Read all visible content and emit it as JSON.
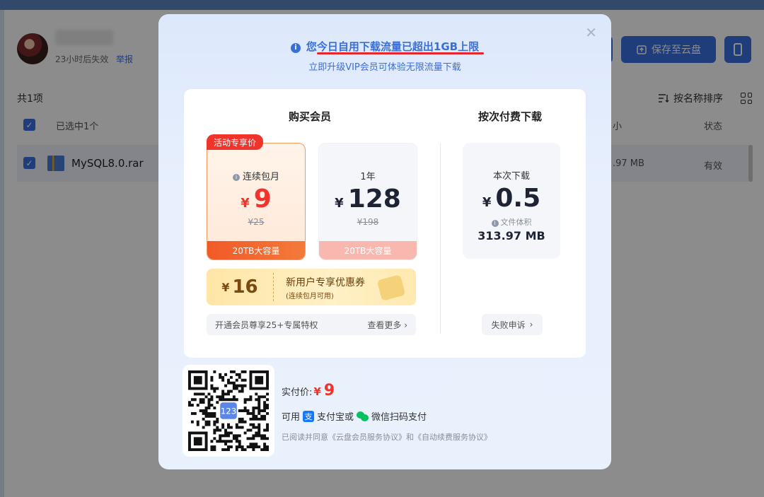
{
  "background": {
    "user": {
      "expire_text": "23小时后失效",
      "report_label": "举报"
    },
    "toolbar": {
      "save_label": "保存至云盘",
      "sort_label": "按名称排序"
    },
    "file_count": "共1项",
    "table": {
      "selected_text": "已选中1个",
      "size_header": "小",
      "status_header": "状态",
      "row": {
        "name": "MySQL8.0.rar",
        "size": ".97 MB",
        "status": "有效"
      }
    }
  },
  "modal": {
    "title": "您今日自用下载流量已超出1GB上限",
    "subtitle": "立即升级VIP会员可体验无限流量下载",
    "buy_section_title": "购买会员",
    "per_download_title": "按次付费下载",
    "badge": "活动专享价",
    "plans": [
      {
        "name": "连续包月",
        "currency": "¥",
        "price": "9",
        "original": "¥25",
        "capacity": "20TB大容量"
      },
      {
        "name": "1年",
        "currency": "¥",
        "price": "128",
        "original": "¥198",
        "capacity": "20TB大容量"
      }
    ],
    "coupon": {
      "currency": "¥",
      "amount": "16",
      "title": "新用户专享优惠券",
      "note": "(连续包月可用)"
    },
    "perks": {
      "text": "开通会员尊享25+专属特权",
      "more": "查看更多"
    },
    "per_download": {
      "name": "本次下载",
      "currency": "¥",
      "price": "0.5",
      "volume_label": "文件体积",
      "volume": "313.97 MB",
      "fail_label": "失败申诉"
    },
    "payment": {
      "paid_label": "实付价:",
      "currency": "¥",
      "amount": "9",
      "method_prefix": "可用",
      "alipay": "支付宝或",
      "wechat": "微信扫码支付",
      "agreement": "已阅读并同意《云盘会员服务协议》和《自动续费服务协议》",
      "qr_logo": "123"
    }
  }
}
